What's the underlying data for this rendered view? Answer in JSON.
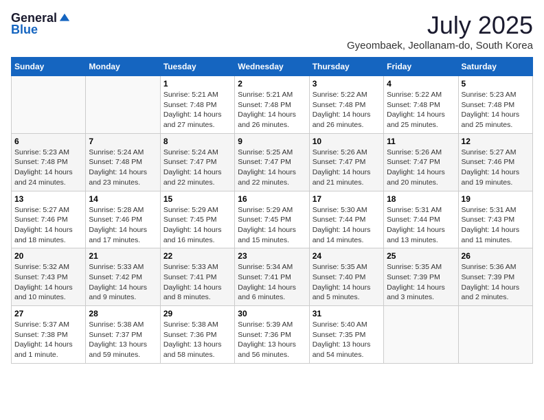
{
  "header": {
    "logo_general": "General",
    "logo_blue": "Blue",
    "month_title": "July 2025",
    "location": "Gyeombaek, Jeollanam-do, South Korea"
  },
  "days_of_week": [
    "Sunday",
    "Monday",
    "Tuesday",
    "Wednesday",
    "Thursday",
    "Friday",
    "Saturday"
  ],
  "weeks": [
    [
      {
        "day": "",
        "info": ""
      },
      {
        "day": "",
        "info": ""
      },
      {
        "day": "1",
        "info": "Sunrise: 5:21 AM\nSunset: 7:48 PM\nDaylight: 14 hours and 27 minutes."
      },
      {
        "day": "2",
        "info": "Sunrise: 5:21 AM\nSunset: 7:48 PM\nDaylight: 14 hours and 26 minutes."
      },
      {
        "day": "3",
        "info": "Sunrise: 5:22 AM\nSunset: 7:48 PM\nDaylight: 14 hours and 26 minutes."
      },
      {
        "day": "4",
        "info": "Sunrise: 5:22 AM\nSunset: 7:48 PM\nDaylight: 14 hours and 25 minutes."
      },
      {
        "day": "5",
        "info": "Sunrise: 5:23 AM\nSunset: 7:48 PM\nDaylight: 14 hours and 25 minutes."
      }
    ],
    [
      {
        "day": "6",
        "info": "Sunrise: 5:23 AM\nSunset: 7:48 PM\nDaylight: 14 hours and 24 minutes."
      },
      {
        "day": "7",
        "info": "Sunrise: 5:24 AM\nSunset: 7:48 PM\nDaylight: 14 hours and 23 minutes."
      },
      {
        "day": "8",
        "info": "Sunrise: 5:24 AM\nSunset: 7:47 PM\nDaylight: 14 hours and 22 minutes."
      },
      {
        "day": "9",
        "info": "Sunrise: 5:25 AM\nSunset: 7:47 PM\nDaylight: 14 hours and 22 minutes."
      },
      {
        "day": "10",
        "info": "Sunrise: 5:26 AM\nSunset: 7:47 PM\nDaylight: 14 hours and 21 minutes."
      },
      {
        "day": "11",
        "info": "Sunrise: 5:26 AM\nSunset: 7:47 PM\nDaylight: 14 hours and 20 minutes."
      },
      {
        "day": "12",
        "info": "Sunrise: 5:27 AM\nSunset: 7:46 PM\nDaylight: 14 hours and 19 minutes."
      }
    ],
    [
      {
        "day": "13",
        "info": "Sunrise: 5:27 AM\nSunset: 7:46 PM\nDaylight: 14 hours and 18 minutes."
      },
      {
        "day": "14",
        "info": "Sunrise: 5:28 AM\nSunset: 7:46 PM\nDaylight: 14 hours and 17 minutes."
      },
      {
        "day": "15",
        "info": "Sunrise: 5:29 AM\nSunset: 7:45 PM\nDaylight: 14 hours and 16 minutes."
      },
      {
        "day": "16",
        "info": "Sunrise: 5:29 AM\nSunset: 7:45 PM\nDaylight: 14 hours and 15 minutes."
      },
      {
        "day": "17",
        "info": "Sunrise: 5:30 AM\nSunset: 7:44 PM\nDaylight: 14 hours and 14 minutes."
      },
      {
        "day": "18",
        "info": "Sunrise: 5:31 AM\nSunset: 7:44 PM\nDaylight: 14 hours and 13 minutes."
      },
      {
        "day": "19",
        "info": "Sunrise: 5:31 AM\nSunset: 7:43 PM\nDaylight: 14 hours and 11 minutes."
      }
    ],
    [
      {
        "day": "20",
        "info": "Sunrise: 5:32 AM\nSunset: 7:43 PM\nDaylight: 14 hours and 10 minutes."
      },
      {
        "day": "21",
        "info": "Sunrise: 5:33 AM\nSunset: 7:42 PM\nDaylight: 14 hours and 9 minutes."
      },
      {
        "day": "22",
        "info": "Sunrise: 5:33 AM\nSunset: 7:41 PM\nDaylight: 14 hours and 8 minutes."
      },
      {
        "day": "23",
        "info": "Sunrise: 5:34 AM\nSunset: 7:41 PM\nDaylight: 14 hours and 6 minutes."
      },
      {
        "day": "24",
        "info": "Sunrise: 5:35 AM\nSunset: 7:40 PM\nDaylight: 14 hours and 5 minutes."
      },
      {
        "day": "25",
        "info": "Sunrise: 5:35 AM\nSunset: 7:39 PM\nDaylight: 14 hours and 3 minutes."
      },
      {
        "day": "26",
        "info": "Sunrise: 5:36 AM\nSunset: 7:39 PM\nDaylight: 14 hours and 2 minutes."
      }
    ],
    [
      {
        "day": "27",
        "info": "Sunrise: 5:37 AM\nSunset: 7:38 PM\nDaylight: 14 hours and 1 minute."
      },
      {
        "day": "28",
        "info": "Sunrise: 5:38 AM\nSunset: 7:37 PM\nDaylight: 13 hours and 59 minutes."
      },
      {
        "day": "29",
        "info": "Sunrise: 5:38 AM\nSunset: 7:36 PM\nDaylight: 13 hours and 58 minutes."
      },
      {
        "day": "30",
        "info": "Sunrise: 5:39 AM\nSunset: 7:36 PM\nDaylight: 13 hours and 56 minutes."
      },
      {
        "day": "31",
        "info": "Sunrise: 5:40 AM\nSunset: 7:35 PM\nDaylight: 13 hours and 54 minutes."
      },
      {
        "day": "",
        "info": ""
      },
      {
        "day": "",
        "info": ""
      }
    ]
  ]
}
